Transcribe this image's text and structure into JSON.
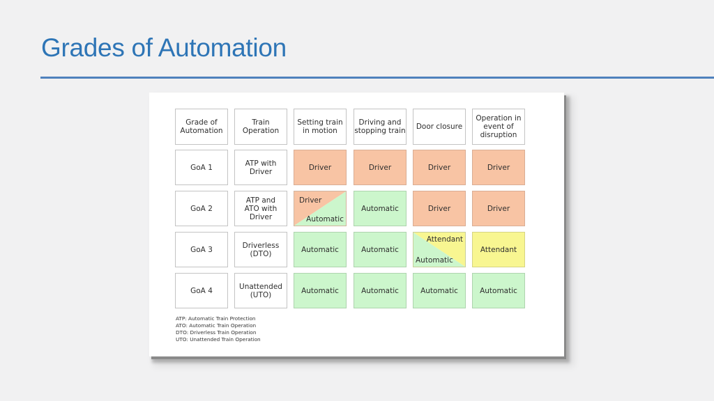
{
  "slide": {
    "title": "Grades of Automation"
  },
  "colors": {
    "title": "#2e75b6",
    "rule": "#4f81bd",
    "driver": "#f8c4a4",
    "automatic": "#ccf6cc",
    "attendant": "#f8f691"
  },
  "table": {
    "headers": [
      "Grade of\nAutomation",
      "Train\nOperation",
      "Setting train\nin motion",
      "Driving and\nstopping train",
      "Door closure",
      "Operation in\nevent of\ndisruption"
    ],
    "rows": [
      {
        "grade": "GoA 1",
        "operation": "ATP with\nDriver",
        "cells": [
          {
            "type": "driver",
            "label": "Driver"
          },
          {
            "type": "driver",
            "label": "Driver"
          },
          {
            "type": "driver",
            "label": "Driver"
          },
          {
            "type": "driver",
            "label": "Driver"
          }
        ]
      },
      {
        "grade": "GoA 2",
        "operation": "ATP and\nATO with\nDriver",
        "cells": [
          {
            "type": "split",
            "top_label": "Driver",
            "bottom_label": "Automatic"
          },
          {
            "type": "automatic",
            "label": "Automatic"
          },
          {
            "type": "driver",
            "label": "Driver"
          },
          {
            "type": "driver",
            "label": "Driver"
          }
        ]
      },
      {
        "grade": "GoA 3",
        "operation": "Driverless\n(DTO)",
        "cells": [
          {
            "type": "automatic",
            "label": "Automatic"
          },
          {
            "type": "automatic",
            "label": "Automatic"
          },
          {
            "type": "split",
            "top_label": "Attendant",
            "bottom_label": "Automatic"
          },
          {
            "type": "attendant",
            "label": "Attendant"
          }
        ]
      },
      {
        "grade": "GoA 4",
        "operation": "Unattended\n(UTO)",
        "cells": [
          {
            "type": "automatic",
            "label": "Automatic"
          },
          {
            "type": "automatic",
            "label": "Automatic"
          },
          {
            "type": "automatic",
            "label": "Automatic"
          },
          {
            "type": "automatic",
            "label": "Automatic"
          }
        ]
      }
    ]
  },
  "legend": [
    "ATP: Automatic Train Protection",
    "ATO: Automatic Train Operation",
    "DTO: Driverless Train Operation",
    "UTO: Unattended Train Operation"
  ]
}
